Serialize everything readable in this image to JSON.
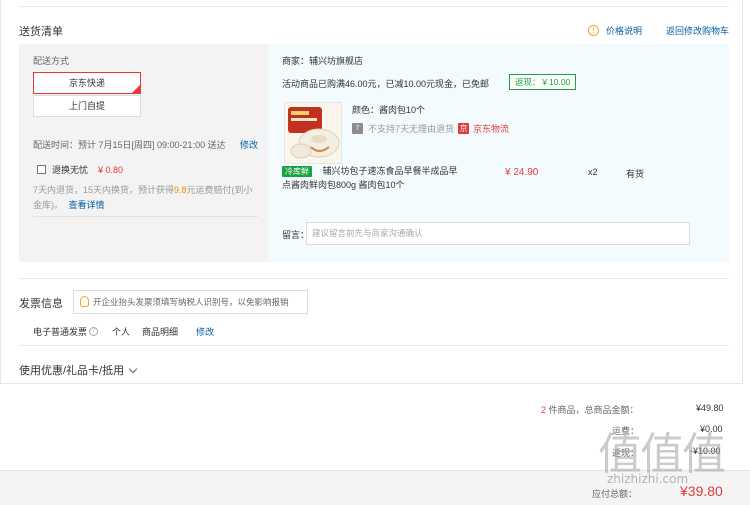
{
  "delivery": {
    "section_title": "送货清单",
    "price_help": "价格说明",
    "back_to_cart": "返回修改购物车",
    "shipping_method_label": "配送方式",
    "options": [
      "京东快递",
      "上门自提"
    ],
    "delivery_time_label": "配送时间：",
    "delivery_time_value": "预计 7月15日[周四] 09:00-21:00 送达",
    "modify": "修改",
    "worry_free_label": "退换无忧",
    "worry_free_price": "¥ 0.80",
    "policy_text_1": "7天内退货，15天内换货，预计获得",
    "policy_highlight": "9.8",
    "policy_text_2": "元运费赔付(到小",
    "policy_text_3": "金库)。",
    "view_details": "查看详情"
  },
  "shop": {
    "merchant_label": "商家：",
    "merchant_name": "辅兴坊旗舰店",
    "promo": "活动商品已购满46.00元，已减10.00元现金，已免邮",
    "cashback": "返现：￥10.00",
    "color_label": "颜色：",
    "color_value": "酱肉包10个",
    "no7_icon": "7",
    "no_return_text": "不支持7天无理由退货",
    "jd_logo": "京",
    "jd_logistics": "京东物流",
    "fresh_tag": "冷库鲜",
    "product_name_1": "辅兴坊包子速冻食品早餐半成品早",
    "product_name_2": "点酱肉鲜肉包800g 酱肉包10个",
    "price": "¥ 24.90",
    "qty": "x2",
    "stock": "有货",
    "note_label": "留言：",
    "note_placeholder": "建议留言前先与商家沟通确认"
  },
  "invoice": {
    "title": "发票信息",
    "tip": "开企业抬头发票须填写纳税人识别号，以免影响报销",
    "type": "电子普通发票",
    "person": "个人",
    "detail": "商品明细",
    "modify": "修改"
  },
  "coupon": {
    "title": "使用优惠/礼品卡/抵用"
  },
  "summary": {
    "count": "2",
    "count_suffix": "件商品，总商品金额：",
    "total": "¥49.80",
    "freight_label": "运费：",
    "freight": "¥0.00",
    "cashback_label": "返现：",
    "cashback": "-¥10.00",
    "payable_label": "应付总额：",
    "payable": "¥39.80"
  },
  "watermark": {
    "logo_text": "值值值",
    "url": "zhizhizhi.com"
  },
  "colors": {
    "accent_red": "#e4393c",
    "link_blue": "#005ea7",
    "cashback_green": "#1aa33e",
    "info_orange": "#f5a623"
  }
}
